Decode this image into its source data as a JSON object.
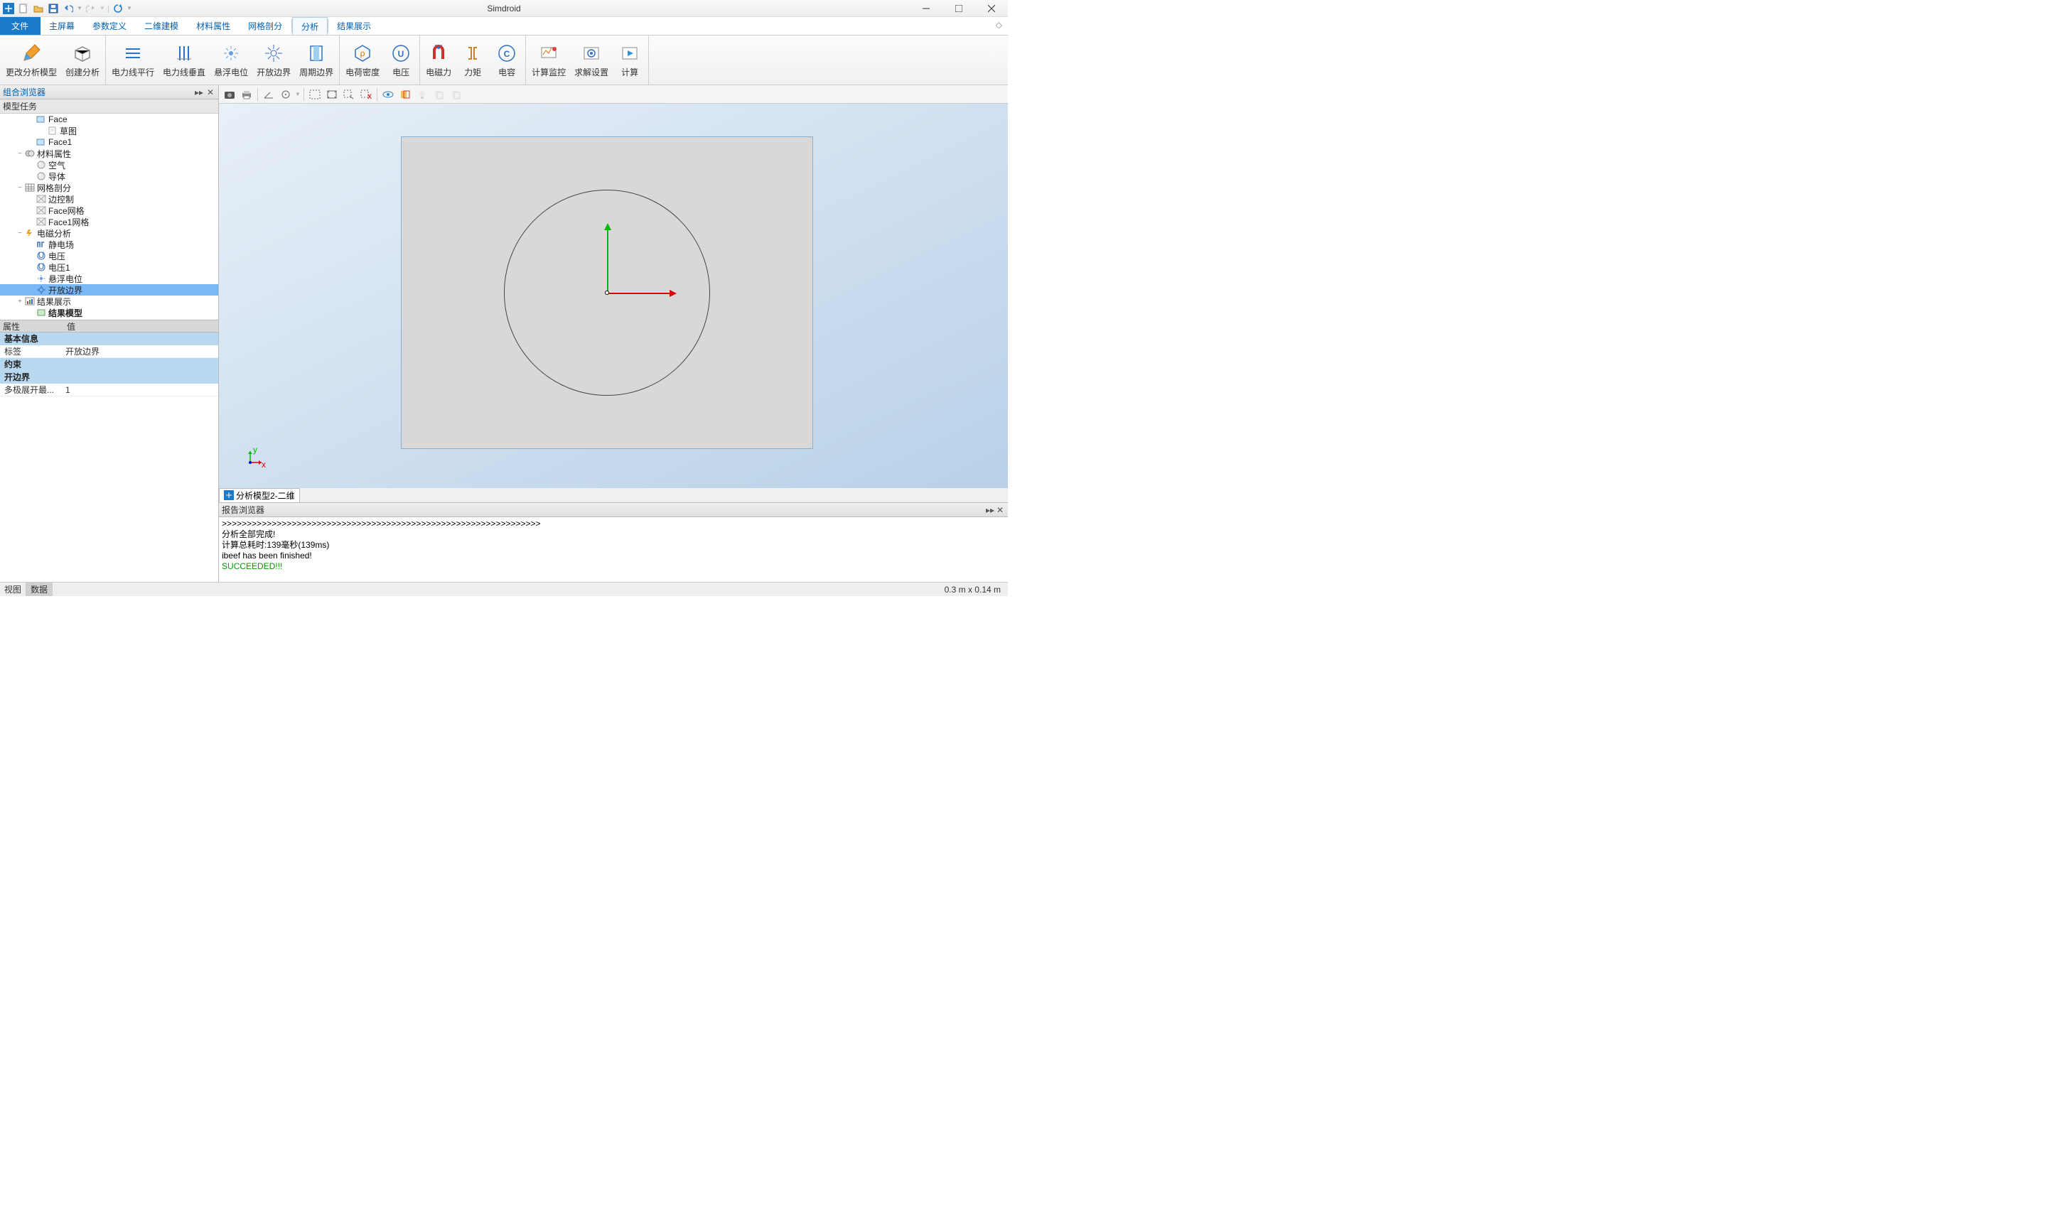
{
  "app": {
    "title": "Simdroid"
  },
  "qat": [
    "logo",
    "new",
    "open",
    "save",
    "undo",
    "redo",
    "refresh"
  ],
  "menu": {
    "file": "文件",
    "items": [
      "主屏幕",
      "参数定义",
      "二维建模",
      "材料属性",
      "网格剖分",
      "分析",
      "结果展示"
    ],
    "active": 5
  },
  "ribbon": {
    "groups": [
      {
        "buttons": [
          {
            "id": "change-model",
            "label": "更改分析模型",
            "icon": "pencil"
          },
          {
            "id": "create-analysis",
            "label": "创建分析",
            "icon": "cube"
          }
        ]
      },
      {
        "buttons": [
          {
            "id": "parallel",
            "label": "电力线平行",
            "icon": "lines-h"
          },
          {
            "id": "perpendicular",
            "label": "电力线垂直",
            "icon": "lines-v"
          },
          {
            "id": "float",
            "label": "悬浮电位",
            "icon": "sparkle"
          },
          {
            "id": "open-boundary",
            "label": "开放边界",
            "icon": "rays"
          },
          {
            "id": "periodic",
            "label": "周期边界",
            "icon": "door"
          }
        ]
      },
      {
        "buttons": [
          {
            "id": "charge",
            "label": "电荷密度",
            "icon": "hex"
          },
          {
            "id": "voltage",
            "label": "电压",
            "icon": "u-circle"
          }
        ]
      },
      {
        "buttons": [
          {
            "id": "emforce",
            "label": "电磁力",
            "icon": "magnet"
          },
          {
            "id": "torque",
            "label": "力矩",
            "icon": "bracket"
          },
          {
            "id": "capacitance",
            "label": "电容",
            "icon": "c-circle"
          }
        ]
      },
      {
        "buttons": [
          {
            "id": "monitor",
            "label": "计算监控",
            "icon": "monitor"
          },
          {
            "id": "solver-settings",
            "label": "求解设置",
            "icon": "gear2"
          },
          {
            "id": "compute",
            "label": "计算",
            "icon": "play"
          }
        ]
      }
    ]
  },
  "sidebar": {
    "title": "组合浏览器",
    "task": "模型任务"
  },
  "tree": [
    {
      "d": 2,
      "t": "",
      "icon": "face",
      "label": "Face"
    },
    {
      "d": 3,
      "t": "",
      "icon": "sketch",
      "label": "草图"
    },
    {
      "d": 2,
      "t": "",
      "icon": "face",
      "label": "Face1"
    },
    {
      "d": 1,
      "t": "−",
      "icon": "materials",
      "label": "材料属性"
    },
    {
      "d": 2,
      "t": "",
      "icon": "mat",
      "label": "空气"
    },
    {
      "d": 2,
      "t": "",
      "icon": "mat",
      "label": "导体"
    },
    {
      "d": 1,
      "t": "−",
      "icon": "mesh",
      "label": "网格剖分"
    },
    {
      "d": 2,
      "t": "",
      "icon": "mctl",
      "label": "边控制"
    },
    {
      "d": 2,
      "t": "",
      "icon": "mctl",
      "label": "Face网格"
    },
    {
      "d": 2,
      "t": "",
      "icon": "mctl",
      "label": "Face1网格"
    },
    {
      "d": 1,
      "t": "−",
      "icon": "em",
      "label": "电磁分析"
    },
    {
      "d": 2,
      "t": "",
      "icon": "field",
      "label": "静电场"
    },
    {
      "d": 2,
      "t": "",
      "icon": "uv",
      "label": "电压"
    },
    {
      "d": 2,
      "t": "",
      "icon": "uv",
      "label": "电压1"
    },
    {
      "d": 2,
      "t": "",
      "icon": "float",
      "label": "悬浮电位"
    },
    {
      "d": 2,
      "t": "",
      "icon": "openb",
      "label": "开放边界",
      "selected": true
    },
    {
      "d": 1,
      "t": "+",
      "icon": "result",
      "label": "结果展示"
    },
    {
      "d": 2,
      "t": "",
      "icon": "rmodel",
      "label": "结果模型",
      "bold": true
    }
  ],
  "props": {
    "header": {
      "attr": "属性",
      "val": "值"
    },
    "section1": "基本信息",
    "row1": {
      "k": "标签",
      "v": "开放边界"
    },
    "section2": "约束",
    "section3": "开边界",
    "row2": {
      "k": "多极展开最...",
      "v": "1"
    }
  },
  "viewTab": "分析模型2-二维",
  "report": {
    "title": "报告浏览器",
    "line1": ">>>>>>>>>>>>>>>>>>>>>>>>>>>>>>>>>>>>>>>>>>>>>>>>>>>>>>>>>>>>>>>>",
    "line2": "分析全部完成!",
    "line3": "计算总耗时:139毫秒(139ms)",
    "line4": "ibeef has been finished!",
    "line5": "SUCCEEDED!!!"
  },
  "status": {
    "tab1": "视图",
    "tab2": "数据",
    "right": "0.3 m x 0.14 m"
  }
}
